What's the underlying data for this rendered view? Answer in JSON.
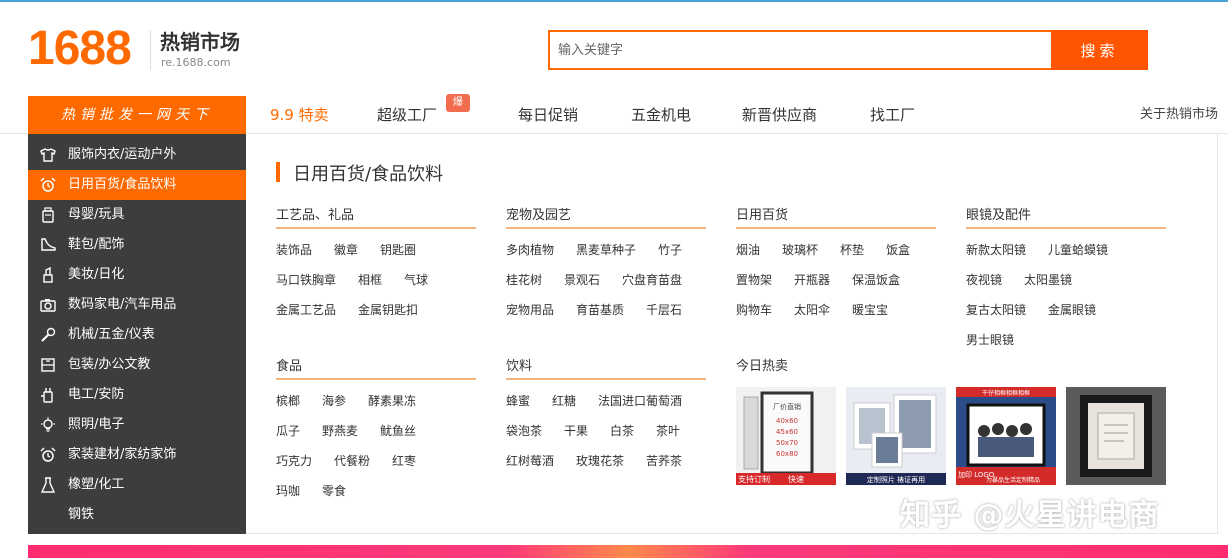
{
  "header": {
    "logo": "1688",
    "brand_title": "热销市场",
    "brand_url": "re.1688.com",
    "search_placeholder": "输入关键字",
    "search_button": "搜索"
  },
  "nav": {
    "slogan": "热销批发一网天下",
    "items": [
      {
        "label": "9.9 特卖"
      },
      {
        "label": "超级工厂"
      },
      {
        "label": "每日促销"
      },
      {
        "label": "五金机电"
      },
      {
        "label": "新晋供应商"
      },
      {
        "label": "找工厂"
      }
    ],
    "badge": "爆",
    "about": "关于热销市场"
  },
  "sidebar": {
    "items": [
      {
        "label": "服饰内衣/运动户外",
        "icon": "shirt-icon"
      },
      {
        "label": "日用百货/食品饮料",
        "icon": "alarm-clock-icon"
      },
      {
        "label": "母婴/玩具",
        "icon": "bottle-icon"
      },
      {
        "label": "鞋包/配饰",
        "icon": "shoe-icon"
      },
      {
        "label": "美妆/日化",
        "icon": "lipstick-icon"
      },
      {
        "label": "数码家电/汽车用品",
        "icon": "camera-icon"
      },
      {
        "label": "机械/五金/仪表",
        "icon": "wrench-icon"
      },
      {
        "label": "包装/办公文教",
        "icon": "box-icon"
      },
      {
        "label": "电工/安防",
        "icon": "plug-icon"
      },
      {
        "label": "照明/电子",
        "icon": "bulb-icon"
      },
      {
        "label": "家装建材/家纺家饰",
        "icon": "home-clock-icon"
      },
      {
        "label": "橡塑/化工",
        "icon": "flask-icon"
      },
      {
        "label": "钢铁",
        "icon": ""
      }
    ],
    "active_index": 1
  },
  "content": {
    "category_title": "日用百货/食品饮料",
    "groups": [
      {
        "title": "工艺品、礼品",
        "links": [
          "装饰品",
          "徽章",
          "钥匙圈",
          "马口铁胸章",
          "相框",
          "气球",
          "金属工艺品",
          "金属钥匙扣"
        ]
      },
      {
        "title": "宠物及园艺",
        "links": [
          "多肉植物",
          "黑麦草种子",
          "竹子",
          "桂花树",
          "景观石",
          "穴盘育苗盘",
          "宠物用品",
          "育苗基质",
          "千层石"
        ]
      },
      {
        "title": "日用百货",
        "links": [
          "烟油",
          "玻璃杯",
          "杯垫",
          "饭盒",
          "置物架",
          "开瓶器",
          "保温饭盒",
          "购物车",
          "太阳伞",
          "暖宝宝"
        ]
      },
      {
        "title": "眼镜及配件",
        "links": [
          "新款太阳镜",
          "儿童蛤蟆镜",
          "夜视镜",
          "太阳墨镜",
          "复古太阳镜",
          "金属眼镜",
          "男士眼镜"
        ]
      },
      {
        "title": "食品",
        "links": [
          "槟榔",
          "海参",
          "酵素果冻",
          "瓜子",
          "野燕麦",
          "鱿鱼丝",
          "巧克力",
          "代餐粉",
          "红枣",
          "玛咖",
          "零食"
        ]
      },
      {
        "title": "饮料",
        "links": [
          "蜂蜜",
          "红糖",
          "法国进口葡萄酒",
          "袋泡茶",
          "干果",
          "白茶",
          "茶叶",
          "红树莓酒",
          "玫瑰花茶",
          "苦荞茶"
        ]
      }
    ],
    "hot_title": "今日热卖",
    "hot_items": [
      {
        "caption_top": "厂价直销",
        "sizes": [
          "40x60",
          "45x60",
          "50x70",
          "60x80"
        ],
        "bottom_left": "支持订制",
        "bottom_right": "快速",
        "accent": "#d8282a"
      },
      {
        "caption": "定制照片 裱证再用",
        "accent": "#1e2a55"
      },
      {
        "caption_top": "干仔相框相框相框",
        "bottom_left": "加印 LOGO",
        "bottom_right": "为暴品生活定制精品",
        "accent": "#d32a2a"
      },
      {
        "caption": "",
        "accent": "#3a3a3a"
      }
    ]
  },
  "watermark": "知乎 @火星讲电商"
}
